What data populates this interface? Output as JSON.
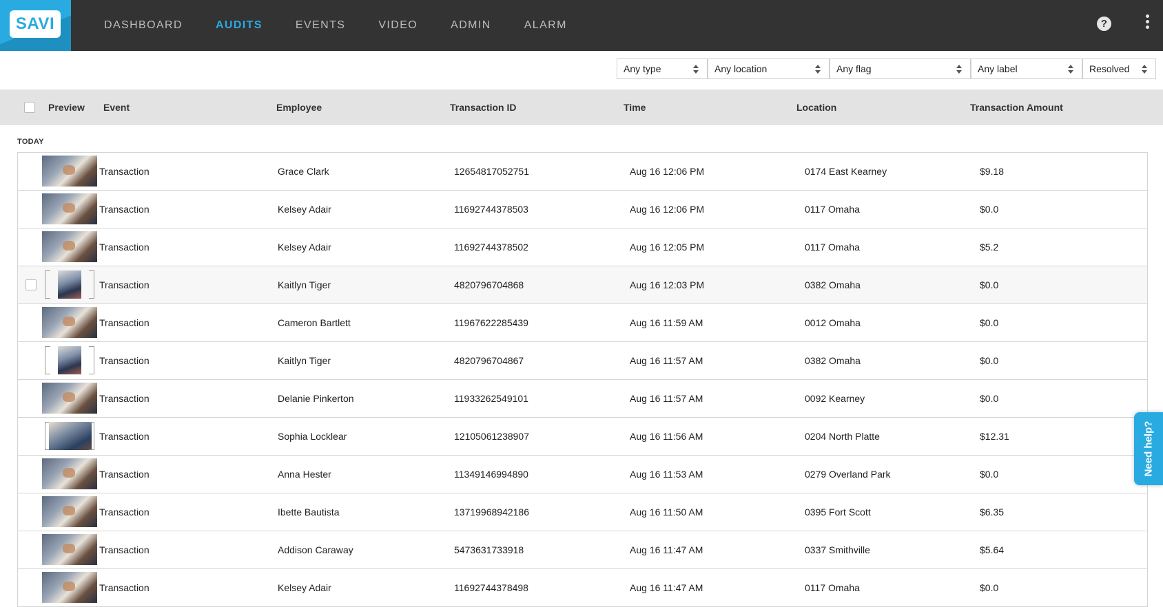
{
  "app": {
    "logo_text": "SAVI",
    "accent_color": "#29abe2",
    "nav_bg": "#333333"
  },
  "nav": {
    "items": [
      {
        "label": "DASHBOARD",
        "active": false
      },
      {
        "label": "AUDITS",
        "active": true
      },
      {
        "label": "EVENTS",
        "active": false
      },
      {
        "label": "VIDEO",
        "active": false
      },
      {
        "label": "ADMIN",
        "active": false
      },
      {
        "label": "ALARM",
        "active": false
      }
    ],
    "help_icon": "question-circle-icon",
    "menu_icon": "kebab-menu-icon"
  },
  "filters": {
    "type": "Any type",
    "location": "Any location",
    "flag": "Any flag",
    "label": "Any label",
    "status": "Resolved"
  },
  "table": {
    "columns": {
      "preview": "Preview",
      "event": "Event",
      "employee": "Employee",
      "transaction_id": "Transaction ID",
      "time": "Time",
      "location": "Location",
      "amount": "Transaction Amount"
    },
    "group_label": "TODAY",
    "rows": [
      {
        "event": "Transaction",
        "employee": "Grace Clark",
        "transaction_id": "12654817052751",
        "time": "Aug 16 12:06 PM",
        "location": "0174 East Kearney",
        "amount": "$9.18",
        "thumb": "wide"
      },
      {
        "event": "Transaction",
        "employee": "Kelsey Adair",
        "transaction_id": "11692744378503",
        "time": "Aug 16 12:06 PM",
        "location": "0117 Omaha",
        "amount": "$0.0",
        "thumb": "wide"
      },
      {
        "event": "Transaction",
        "employee": "Kelsey Adair",
        "transaction_id": "11692744378502",
        "time": "Aug 16 12:05 PM",
        "location": "0117 Omaha",
        "amount": "$5.2",
        "thumb": "wide"
      },
      {
        "event": "Transaction",
        "employee": "Kaitlyn Tiger",
        "transaction_id": "4820796704868",
        "time": "Aug 16 12:03 PM",
        "location": "0382 Omaha",
        "amount": "$0.0",
        "thumb": "narrow"
      },
      {
        "event": "Transaction",
        "employee": "Cameron Bartlett",
        "transaction_id": "11967622285439",
        "time": "Aug 16 11:59 AM",
        "location": "0012 Omaha",
        "amount": "$0.0",
        "thumb": "wide"
      },
      {
        "event": "Transaction",
        "employee": "Kaitlyn Tiger",
        "transaction_id": "4820796704867",
        "time": "Aug 16 11:57 AM",
        "location": "0382 Omaha",
        "amount": "$0.0",
        "thumb": "narrow"
      },
      {
        "event": "Transaction",
        "employee": "Delanie Pinkerton",
        "transaction_id": "11933262549101",
        "time": "Aug 16 11:57 AM",
        "location": "0092 Kearney",
        "amount": "$0.0",
        "thumb": "wide"
      },
      {
        "event": "Transaction",
        "employee": "Sophia Locklear",
        "transaction_id": "12105061238907",
        "time": "Aug 16 11:56 AM",
        "location": "0204 North Platte",
        "amount": "$12.31",
        "thumb": "narrow-wide"
      },
      {
        "event": "Transaction",
        "employee": "Anna Hester",
        "transaction_id": "11349146994890",
        "time": "Aug 16 11:53 AM",
        "location": "0279 Overland Park",
        "amount": "$0.0",
        "thumb": "wide"
      },
      {
        "event": "Transaction",
        "employee": "Ibette Bautista",
        "transaction_id": "13719968942186",
        "time": "Aug 16 11:50 AM",
        "location": "0395 Fort Scott",
        "amount": "$6.35",
        "thumb": "wide"
      },
      {
        "event": "Transaction",
        "employee": "Addison Caraway",
        "transaction_id": "5473631733918",
        "time": "Aug 16 11:47 AM",
        "location": "0337 Smithville",
        "amount": "$5.64",
        "thumb": "wide"
      },
      {
        "event": "Transaction",
        "employee": "Kelsey Adair",
        "transaction_id": "11692744378498",
        "time": "Aug 16 11:47 AM",
        "location": "0117 Omaha",
        "amount": "$0.0",
        "thumb": "wide"
      }
    ]
  },
  "help_tab": {
    "label": "Need help?"
  }
}
